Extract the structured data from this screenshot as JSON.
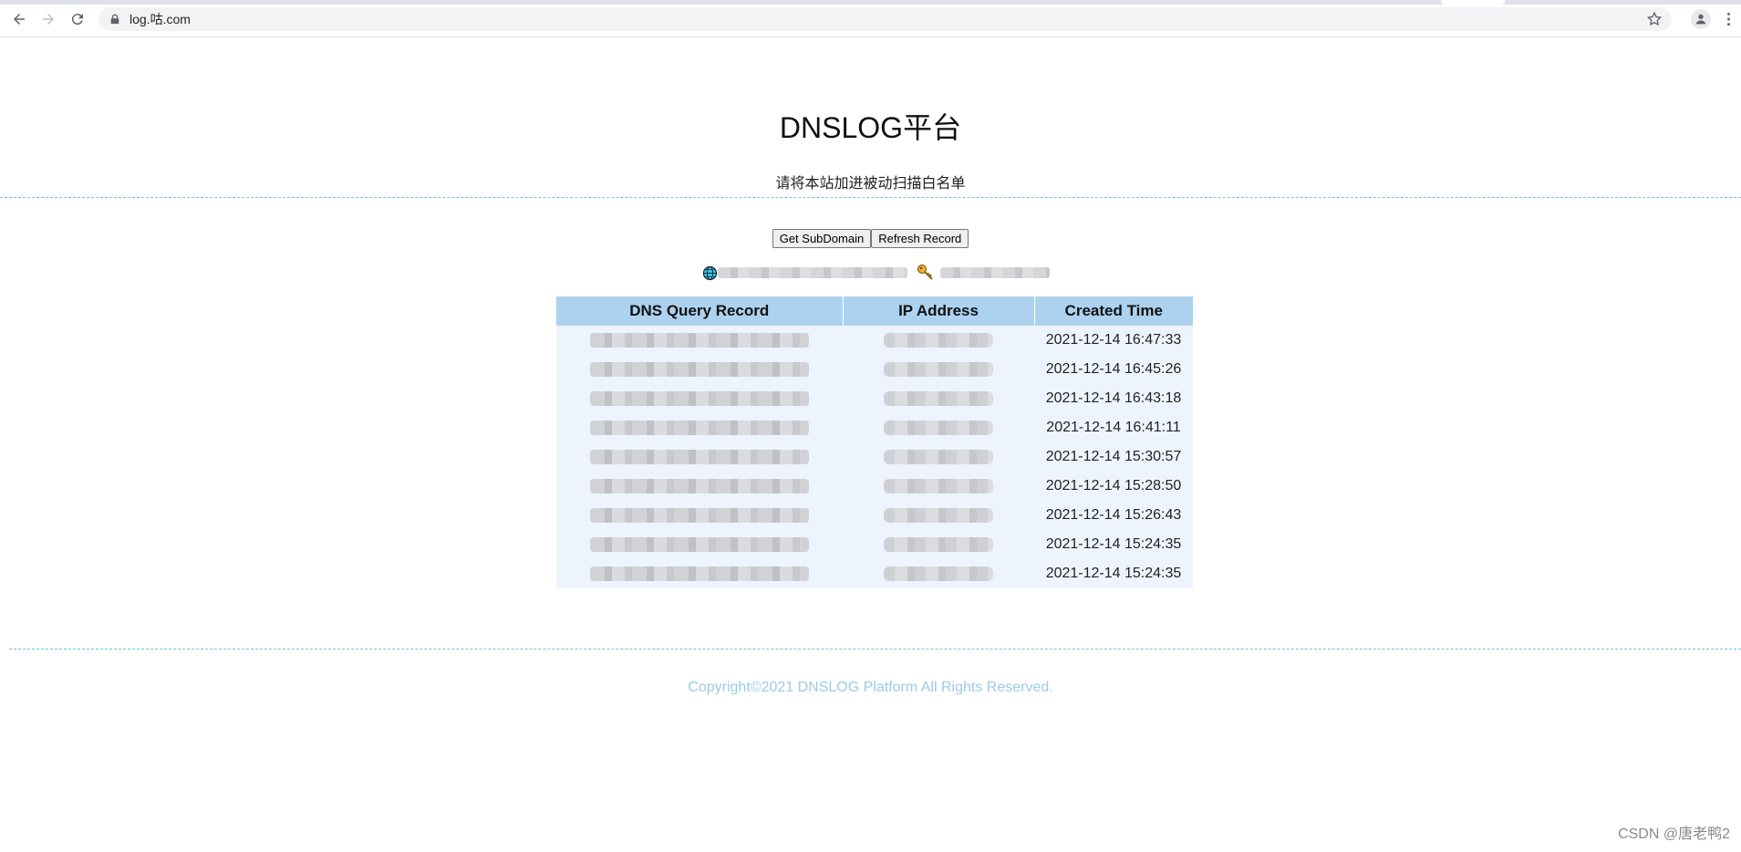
{
  "browser": {
    "url": "log.咕.com"
  },
  "page": {
    "title": "DNSLOG平台",
    "subtitle": "请将本站加进被动扫描白名单",
    "copyright": "Copyright©2021 DNSLOG Platform All Rights Reserved."
  },
  "actions": {
    "get_subdomain": "Get SubDomain",
    "refresh_record": "Refresh Record"
  },
  "table": {
    "headers": [
      "DNS Query Record",
      "IP Address",
      "Created Time"
    ],
    "rows": [
      {
        "time": "2021-12-14 16:47:33"
      },
      {
        "time": "2021-12-14 16:45:26"
      },
      {
        "time": "2021-12-14 16:43:18"
      },
      {
        "time": "2021-12-14 16:41:11"
      },
      {
        "time": "2021-12-14 15:30:57"
      },
      {
        "time": "2021-12-14 15:28:50"
      },
      {
        "time": "2021-12-14 15:26:43"
      },
      {
        "time": "2021-12-14 15:24:35"
      },
      {
        "time": "2021-12-14 15:24:35"
      }
    ]
  },
  "watermark": "CSDN @唐老鸭2",
  "colors": {
    "header_bg": "#acd2ef",
    "row_bg": "#eef4fd",
    "divider": "#6ec3e3",
    "copyright": "#9ccbe6"
  }
}
